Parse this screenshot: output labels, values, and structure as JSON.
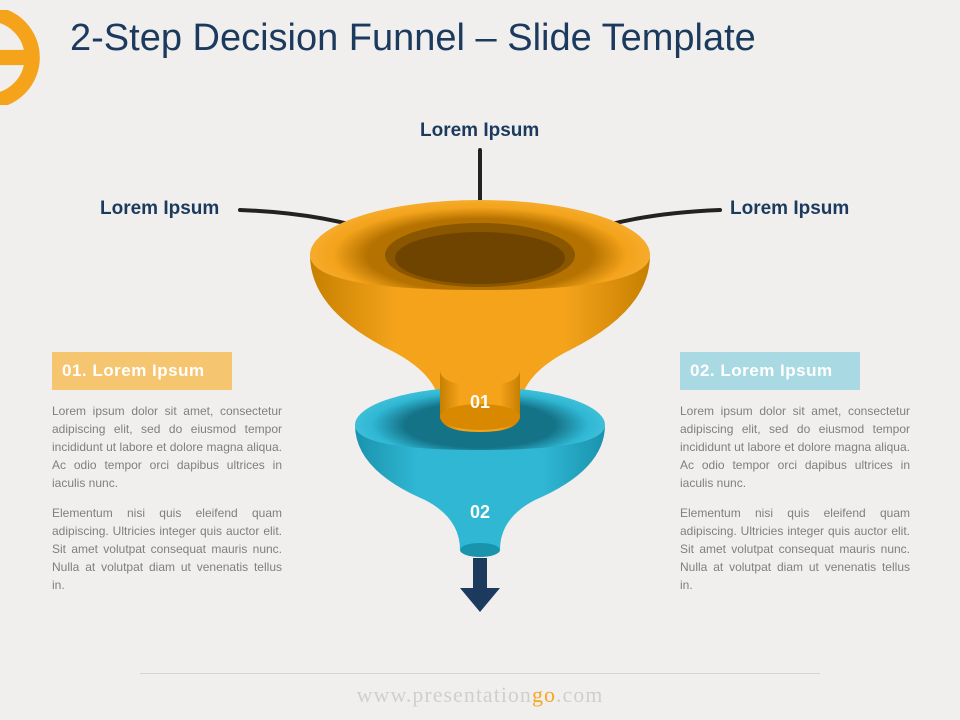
{
  "title": "2-Step Decision Funnel – Slide Template",
  "inputs": {
    "top": "Lorem Ipsum",
    "left": "Lorem Ipsum",
    "right": "Lorem Ipsum"
  },
  "funnel": {
    "step1_number": "01",
    "step2_number": "02"
  },
  "panel_left": {
    "heading": "01. Lorem Ipsum",
    "para1": "Lorem ipsum dolor sit amet, consectetur adipiscing elit, sed do eiusmod tempor incididunt ut labore et dolore magna aliqua. Ac odio tempor orci dapibus ultrices in iaculis nunc.",
    "para2": "Elementum nisi quis eleifend quam adipiscing. Ultricies integer quis auctor elit. Sit amet volutpat consequat mauris nunc. Nulla at volutpat diam ut venenatis tellus in."
  },
  "panel_right": {
    "heading": "02. Lorem Ipsum",
    "para1": "Lorem ipsum dolor sit amet, consectetur adipiscing elit, sed do eiusmod tempor incididunt ut labore et dolore magna aliqua. Ac odio tempor orci dapibus ultrices in iaculis nunc.",
    "para2": "Elementum nisi quis eleifend quam adipiscing. Ultricies integer quis auctor elit. Sit amet volutpat consequat mauris nunc. Nulla at volutpat diam ut venenatis tellus in."
  },
  "footer": {
    "prefix": "www.",
    "brand_pre": "presentation",
    "brand_accent": "go",
    "suffix": ".com"
  },
  "colors": {
    "orange": "#f4a31b",
    "orange_dark": "#d98900",
    "orange_shade": "#b57200",
    "teal": "#2fb7d3",
    "teal_dark": "#1a93ad",
    "navy": "#1b3a5e"
  }
}
